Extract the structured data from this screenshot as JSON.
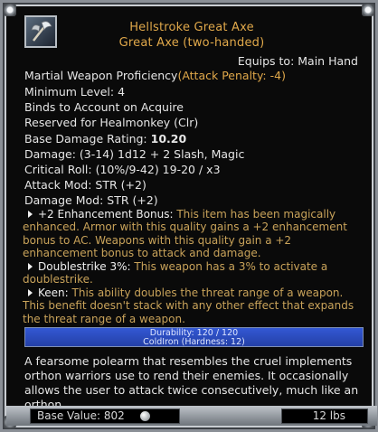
{
  "item": {
    "name_line1": "Hellstroke Great Axe",
    "name_line2": "Great Axe (two-handed)",
    "icon": "great-axe-icon"
  },
  "equips": "Equips to: Main Hand",
  "proficiency": {
    "label": "Martial Weapon Proficiency",
    "penalty": "(Attack Penalty: -4)"
  },
  "min_level": "Minimum Level: 4",
  "binds": "Binds to Account on Acquire",
  "reserved": "Reserved for Healmonkey (Clr)",
  "base_damage": {
    "label": "Base Damage Rating: ",
    "value": "10.20"
  },
  "damage": "Damage: (3-14) 1d12 + 2 Slash, Magic",
  "critical": "Critical Roll: (10%/9-42) 19-20 / x3",
  "attack_mod": "Attack Mod: STR (+2)",
  "damage_mod": "Damage Mod: STR (+2)",
  "effects": [
    {
      "name": "+2 Enhancement Bonus:",
      "text": " This item has been magically enhanced. Armor with this quality gains a +2 enhancement bonus to AC. Weapons with this quality gain a +2 enhancement bonus to attack and damage."
    },
    {
      "name": "Doublestrike 3%:",
      "text": " This weapon has a 3% to activate a doublestrike."
    },
    {
      "name": "Keen:",
      "text": " This ability doubles the threat range of a weapon. This benefit doesn't stack with any other effect that expands the threat range of a weapon."
    }
  ],
  "durability": {
    "text": "Durability: 120 / 120",
    "current": 120,
    "max": 120
  },
  "material": "ColdIron (Hardness: 12)",
  "description": "A fearsome polearm that resembles the cruel implements orthon warriors use to rend their enemies. It occasionally allows the user to attack twice consecutively, much like an orthon.",
  "footer": {
    "base_value": "Base Value: 802",
    "coin_icon": "platinum-coin-icon",
    "weight": "12 lbs"
  }
}
